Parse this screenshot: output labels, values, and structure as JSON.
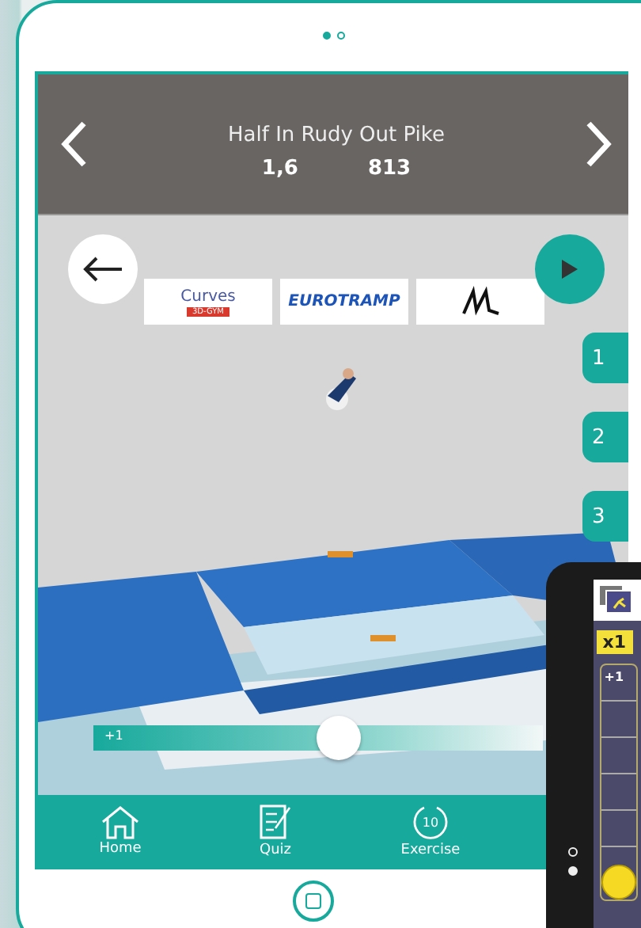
{
  "page_dots": [
    {
      "selected": true
    },
    {
      "selected": false
    }
  ],
  "header": {
    "title": "Half In Rudy Out Pike",
    "difficulty": "1,6",
    "code": "813"
  },
  "logos": [
    {
      "kind": "curves",
      "text": "Curves",
      "tag": "3D-GYM"
    },
    {
      "kind": "eurotramp",
      "text": "EUROTRAMP"
    },
    {
      "kind": "mark"
    }
  ],
  "side_tabs": [
    {
      "label": "1"
    },
    {
      "label": "2"
    },
    {
      "label": "3"
    }
  ],
  "slider": {
    "label": "+1",
    "level": 0.55
  },
  "nav": [
    {
      "kind": "home",
      "label": "Home"
    },
    {
      "kind": "quiz",
      "label": "Quiz"
    },
    {
      "kind": "exercise",
      "label": "Exercise",
      "badge": "10"
    }
  ],
  "phone": {
    "zoom": "x1",
    "scale_label": "+1",
    "level": 0,
    "dots": [
      {
        "selected": false
      },
      {
        "selected": true
      }
    ]
  }
}
